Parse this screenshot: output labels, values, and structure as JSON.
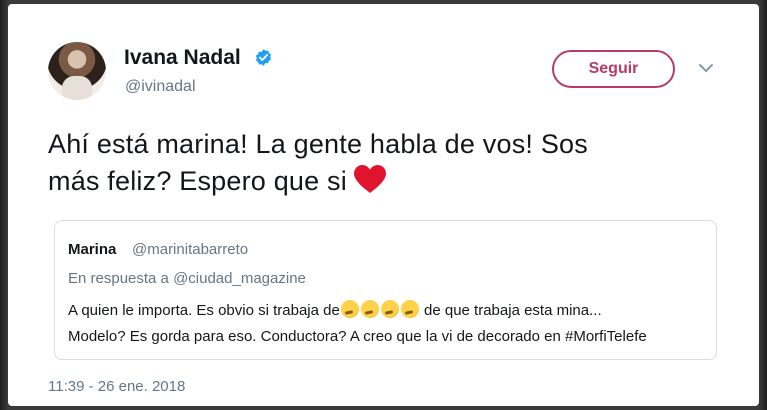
{
  "tweet": {
    "author_name": "Ivana Nadal",
    "author_handle": "@ivinadal",
    "follow_label": "Seguir",
    "text_line1": "Ahí está marina! La gente habla de vos! Sos",
    "text_line2": "más feliz? Espero que si",
    "timestamp": "11:39 - 26 ene. 2018",
    "accent_color": "#b73b68",
    "verified_color": "#1da1f2"
  },
  "quoted_tweet": {
    "author_name": "Marina",
    "author_handle": "@marinitabarreto",
    "reply_to": "En respuesta a @ciudad_magazine",
    "body_part1": "A quien le importa. Es obvio si trabaja de",
    "body_part2": " de que trabaja esta mina...",
    "body_line2": "Modelo? Es gorda para eso. Conductora? A creo que la vi de decorado en #MorfiTelefe",
    "emoji_count": 4
  },
  "icons": {
    "verified": "verified-badge-icon",
    "menu": "chevron-down-icon",
    "heart": "red-heart-emoji",
    "thinking": "thinking-face-emoji"
  }
}
